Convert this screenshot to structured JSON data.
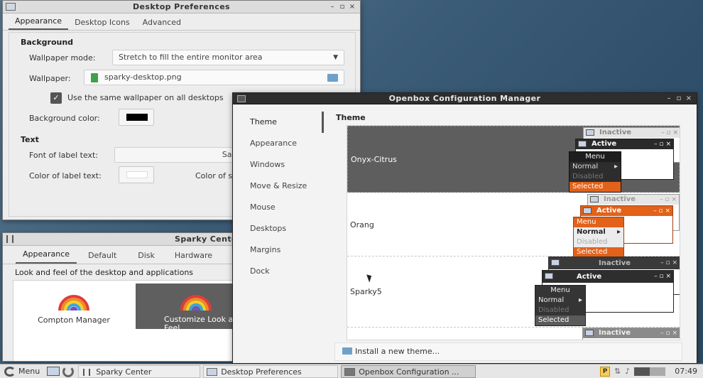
{
  "desktop_prefs": {
    "title": "Desktop Preferences",
    "tabs": [
      "Appearance",
      "Desktop Icons",
      "Advanced"
    ],
    "background_heading": "Background",
    "wallpaper_mode_label": "Wallpaper mode:",
    "wallpaper_mode_value": "Stretch to fill the entire monitor area",
    "wallpaper_label": "Wallpaper:",
    "wallpaper_value": "sparky-desktop.png",
    "same_wallpaper_label": "Use the same wallpaper on all desktops",
    "bg_color_label": "Background color:",
    "bg_color": "#000000",
    "text_heading": "Text",
    "font_label": "Font of label text:",
    "font_value": "Sans",
    "label_color_label": "Color of label text:",
    "shadow_color_label": "Color of shadow:",
    "label_color": "#ffffff"
  },
  "sparky_center": {
    "title": "Sparky Center",
    "tabs": [
      "Appearance",
      "Default",
      "Disk",
      "Hardware"
    ],
    "description": "Look and feel of the desktop and applications",
    "items": [
      {
        "label": "Compton Manager"
      },
      {
        "label": "Customize Look and Feel"
      }
    ]
  },
  "obconf": {
    "title": "Openbox Configuration Manager",
    "sidebar": [
      "Theme",
      "Appearance",
      "Windows",
      "Move & Resize",
      "Mouse",
      "Desktops",
      "Margins",
      "Dock"
    ],
    "heading": "Theme",
    "themes": [
      {
        "name": "Onyx-Citrus"
      },
      {
        "name": "Orang"
      },
      {
        "name": "Sparky5"
      }
    ],
    "preview": {
      "inactive": "Inactive",
      "active": "Active",
      "menu": "Menu",
      "normal": "Normal",
      "disabled": "Disabled",
      "selected": "Selected"
    },
    "install_button": "Install a new theme..."
  },
  "taskbar": {
    "menu_label": "Menu",
    "tasks": [
      "Sparky Center",
      "Desktop Preferences",
      "Openbox Configuration ..."
    ],
    "clock": "07:49"
  },
  "colors": {
    "orange": "#e2621a",
    "dark_preview": "#3a3a3a"
  }
}
